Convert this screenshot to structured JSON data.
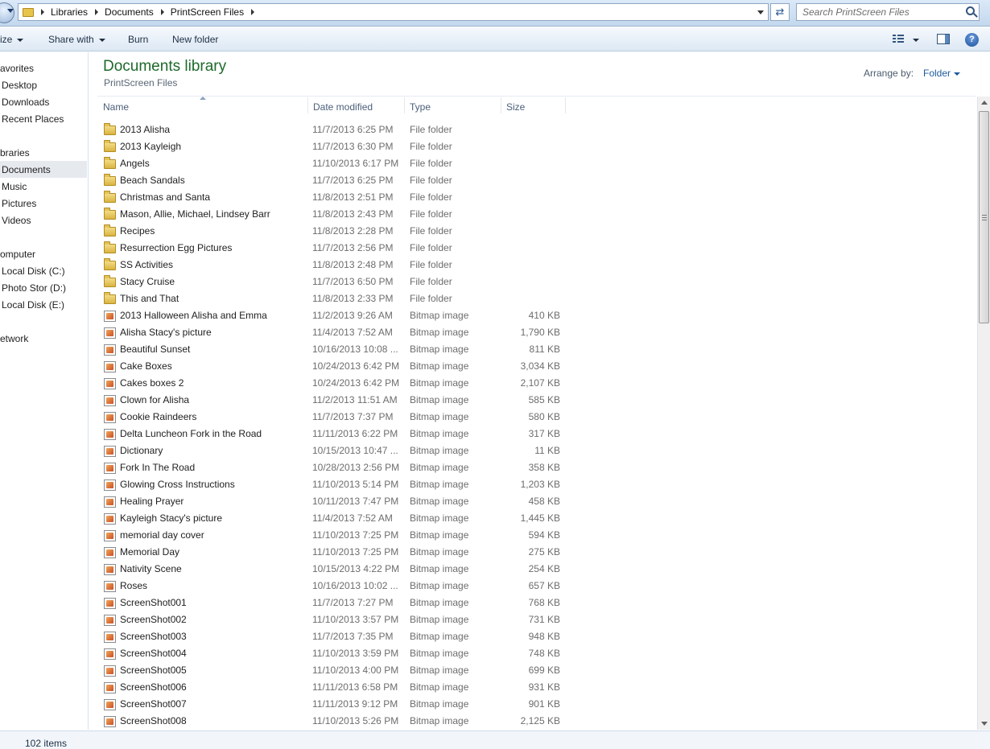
{
  "address": {
    "breadcrumbs": [
      "Libraries",
      "Documents",
      "PrintScreen Files"
    ],
    "search_placeholder": "Search PrintScreen Files"
  },
  "toolbar": {
    "organize_label": "ize",
    "share_label": "Share with",
    "burn_label": "Burn",
    "new_folder_label": "New folder"
  },
  "nav": {
    "favorites": "avorites",
    "favorites_items": [
      "Desktop",
      "Downloads",
      "Recent Places"
    ],
    "libraries": "braries",
    "libraries_items": [
      "Documents",
      "Music",
      "Pictures",
      "Videos"
    ],
    "computer": "omputer",
    "computer_items": [
      "Local Disk (C:)",
      "Photo Stor (D:)",
      "Local Disk (E:)"
    ],
    "network": "etwork",
    "selected": "Documents"
  },
  "library": {
    "title": "Documents library",
    "subtitle": "PrintScreen Files",
    "arrange_label": "Arrange by:",
    "arrange_value": "Folder"
  },
  "columns": [
    "Name",
    "Date modified",
    "Type",
    "Size"
  ],
  "files": [
    {
      "name": "2013 Alisha",
      "date": "11/7/2013 6:25 PM",
      "type": "File folder",
      "size": "",
      "icon": "folder-icon"
    },
    {
      "name": "2013 Kayleigh",
      "date": "11/7/2013 6:30 PM",
      "type": "File folder",
      "size": "",
      "icon": "folder-icon"
    },
    {
      "name": "Angels",
      "date": "11/10/2013 6:17 PM",
      "type": "File folder",
      "size": "",
      "icon": "folder-icon"
    },
    {
      "name": "Beach Sandals",
      "date": "11/7/2013 6:25 PM",
      "type": "File folder",
      "size": "",
      "icon": "folder-icon"
    },
    {
      "name": "Christmas and Santa",
      "date": "11/8/2013 2:51 PM",
      "type": "File folder",
      "size": "",
      "icon": "folder-icon"
    },
    {
      "name": "Mason, Allie, Michael, Lindsey Barr",
      "date": "11/8/2013 2:43 PM",
      "type": "File folder",
      "size": "",
      "icon": "folder-icon"
    },
    {
      "name": "Recipes",
      "date": "11/8/2013 2:28 PM",
      "type": "File folder",
      "size": "",
      "icon": "folder-icon"
    },
    {
      "name": "Resurrection Egg Pictures",
      "date": "11/7/2013 2:56 PM",
      "type": "File folder",
      "size": "",
      "icon": "folder-icon"
    },
    {
      "name": "SS Activities",
      "date": "11/8/2013 2:48 PM",
      "type": "File folder",
      "size": "",
      "icon": "folder-icon"
    },
    {
      "name": "Stacy Cruise",
      "date": "11/7/2013 6:50 PM",
      "type": "File folder",
      "size": "",
      "icon": "folder-icon"
    },
    {
      "name": "This and That",
      "date": "11/8/2013 2:33 PM",
      "type": "File folder",
      "size": "",
      "icon": "folder-icon"
    },
    {
      "name": "2013 Halloween Alisha and Emma",
      "date": "11/2/2013 9:26 AM",
      "type": "Bitmap image",
      "size": "410 KB",
      "icon": "bitmap-icon"
    },
    {
      "name": "Alisha Stacy's picture",
      "date": "11/4/2013 7:52 AM",
      "type": "Bitmap image",
      "size": "1,790 KB",
      "icon": "bitmap-icon"
    },
    {
      "name": "Beautiful Sunset",
      "date": "10/16/2013 10:08 ...",
      "type": "Bitmap image",
      "size": "811 KB",
      "icon": "bitmap-icon"
    },
    {
      "name": "Cake Boxes",
      "date": "10/24/2013 6:42 PM",
      "type": "Bitmap image",
      "size": "3,034 KB",
      "icon": "bitmap-icon"
    },
    {
      "name": "Cakes boxes 2",
      "date": "10/24/2013 6:42 PM",
      "type": "Bitmap image",
      "size": "2,107 KB",
      "icon": "bitmap-icon"
    },
    {
      "name": "Clown for Alisha",
      "date": "11/2/2013 11:51 AM",
      "type": "Bitmap image",
      "size": "585 KB",
      "icon": "bitmap-icon"
    },
    {
      "name": "Cookie Raindeers",
      "date": "11/7/2013 7:37 PM",
      "type": "Bitmap image",
      "size": "580 KB",
      "icon": "bitmap-icon"
    },
    {
      "name": "Delta Luncheon Fork in the Road",
      "date": "11/11/2013 6:22 PM",
      "type": "Bitmap image",
      "size": "317 KB",
      "icon": "bitmap-icon"
    },
    {
      "name": "Dictionary",
      "date": "10/15/2013 10:47 ...",
      "type": "Bitmap image",
      "size": "11 KB",
      "icon": "bitmap-icon"
    },
    {
      "name": "Fork In The Road",
      "date": "10/28/2013 2:56 PM",
      "type": "Bitmap image",
      "size": "358 KB",
      "icon": "bitmap-icon"
    },
    {
      "name": "Glowing Cross Instructions",
      "date": "11/10/2013 5:14 PM",
      "type": "Bitmap image",
      "size": "1,203 KB",
      "icon": "bitmap-icon"
    },
    {
      "name": "Healing Prayer",
      "date": "10/11/2013 7:47 PM",
      "type": "Bitmap image",
      "size": "458 KB",
      "icon": "bitmap-icon"
    },
    {
      "name": "Kayleigh Stacy's picture",
      "date": "11/4/2013 7:52 AM",
      "type": "Bitmap image",
      "size": "1,445 KB",
      "icon": "bitmap-icon"
    },
    {
      "name": "memorial day cover",
      "date": "11/10/2013 7:25 PM",
      "type": "Bitmap image",
      "size": "594 KB",
      "icon": "bitmap-icon"
    },
    {
      "name": "Memorial Day",
      "date": "11/10/2013 7:25 PM",
      "type": "Bitmap image",
      "size": "275 KB",
      "icon": "bitmap-icon"
    },
    {
      "name": "Nativity  Scene",
      "date": "10/15/2013 4:22 PM",
      "type": "Bitmap image",
      "size": "254 KB",
      "icon": "bitmap-icon"
    },
    {
      "name": "Roses",
      "date": "10/16/2013 10:02 ...",
      "type": "Bitmap image",
      "size": "657 KB",
      "icon": "bitmap-icon"
    },
    {
      "name": "ScreenShot001",
      "date": "11/7/2013 7:27 PM",
      "type": "Bitmap image",
      "size": "768 KB",
      "icon": "bitmap-icon"
    },
    {
      "name": "ScreenShot002",
      "date": "11/10/2013 3:57 PM",
      "type": "Bitmap image",
      "size": "731 KB",
      "icon": "bitmap-icon"
    },
    {
      "name": "ScreenShot003",
      "date": "11/7/2013 7:35 PM",
      "type": "Bitmap image",
      "size": "948 KB",
      "icon": "bitmap-icon"
    },
    {
      "name": "ScreenShot004",
      "date": "11/10/2013 3:59 PM",
      "type": "Bitmap image",
      "size": "748 KB",
      "icon": "bitmap-icon"
    },
    {
      "name": "ScreenShot005",
      "date": "11/10/2013 4:00 PM",
      "type": "Bitmap image",
      "size": "699 KB",
      "icon": "bitmap-icon"
    },
    {
      "name": "ScreenShot006",
      "date": "11/11/2013 6:58 PM",
      "type": "Bitmap image",
      "size": "931 KB",
      "icon": "bitmap-icon"
    },
    {
      "name": "ScreenShot007",
      "date": "11/11/2013 9:12 PM",
      "type": "Bitmap image",
      "size": "901 KB",
      "icon": "bitmap-icon"
    },
    {
      "name": "ScreenShot008",
      "date": "11/10/2013 5:26 PM",
      "type": "Bitmap image",
      "size": "2,125 KB",
      "icon": "bitmap-icon"
    }
  ],
  "status": {
    "item_count": "102 items"
  },
  "colors": {
    "title_green": "#1e6a2b",
    "link_blue": "#1e5a9c",
    "selection_gray": "#e6e9ee"
  }
}
